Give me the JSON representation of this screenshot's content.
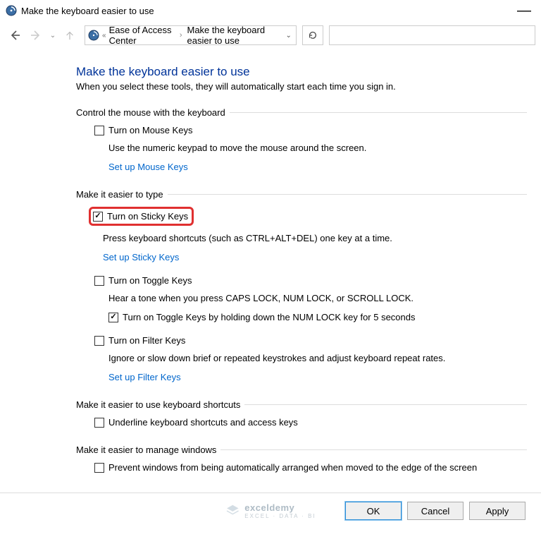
{
  "window": {
    "title": "Make the keyboard easier to use"
  },
  "breadcrumb": {
    "parent": "Ease of Access Center",
    "current": "Make the keyboard easier to use"
  },
  "header": {
    "title": "Make the keyboard easier to use",
    "subtitle": "When you select these tools, they will automatically start each time you sign in."
  },
  "section_mouse": {
    "title": "Control the mouse with the keyboard",
    "mouse_keys": {
      "label": "Turn on Mouse Keys",
      "checked": false,
      "desc": "Use the numeric keypad to move the mouse around the screen.",
      "link": "Set up Mouse Keys"
    }
  },
  "section_type": {
    "title": "Make it easier to type",
    "sticky": {
      "label": "Turn on Sticky Keys",
      "checked": true,
      "desc": "Press keyboard shortcuts (such as CTRL+ALT+DEL) one key at a time.",
      "link": "Set up Sticky Keys"
    },
    "toggle": {
      "label": "Turn on Toggle Keys",
      "checked": false,
      "desc": "Hear a tone when you press CAPS LOCK, NUM LOCK, or SCROLL LOCK.",
      "hold_label": "Turn on Toggle Keys by holding down the NUM LOCK key for 5 seconds",
      "hold_checked": true
    },
    "filter": {
      "label": "Turn on Filter Keys",
      "checked": false,
      "desc": "Ignore or slow down brief or repeated keystrokes and adjust keyboard repeat rates.",
      "link": "Set up Filter Keys"
    }
  },
  "section_shortcuts": {
    "title": "Make it easier to use keyboard shortcuts",
    "underline": {
      "label": "Underline keyboard shortcuts and access keys",
      "checked": false
    }
  },
  "section_windows": {
    "title": "Make it easier to manage windows",
    "prevent": {
      "label": "Prevent windows from being automatically arranged when moved to the edge of the screen",
      "checked": false
    }
  },
  "footer": {
    "ok": "OK",
    "cancel": "Cancel",
    "apply": "Apply"
  },
  "watermark": {
    "brand": "exceldemy",
    "tag": "EXCEL · DATA · BI"
  }
}
